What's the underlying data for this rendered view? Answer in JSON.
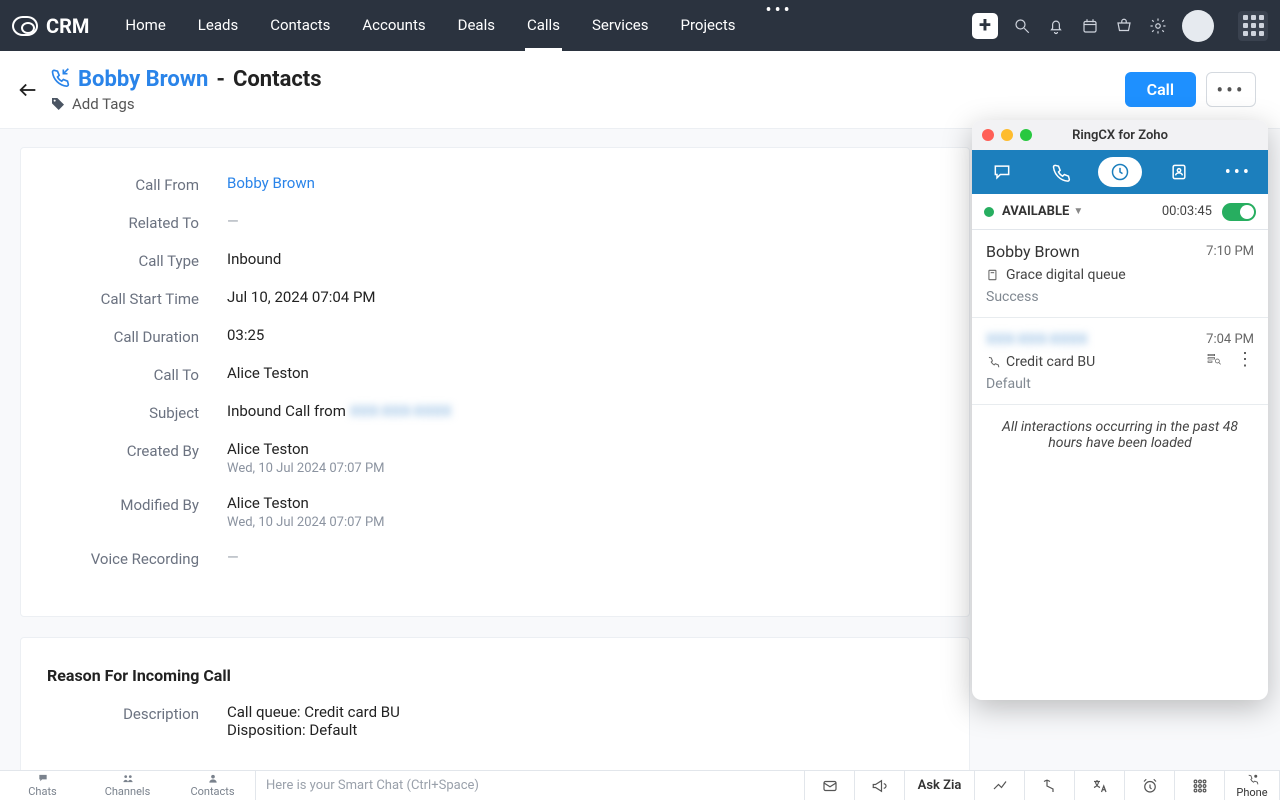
{
  "brand": "CRM",
  "nav": {
    "items": [
      "Home",
      "Leads",
      "Contacts",
      "Accounts",
      "Deals",
      "Calls",
      "Services",
      "Projects"
    ],
    "active": "Calls"
  },
  "header": {
    "contact_name": "Bobby Brown",
    "module": "Contacts",
    "add_tags": "Add Tags",
    "call_btn": "Call"
  },
  "details": {
    "labels": {
      "call_from": "Call From",
      "related_to": "Related To",
      "call_type": "Call Type",
      "call_start": "Call Start Time",
      "call_duration": "Call Duration",
      "call_to": "Call To",
      "subject": "Subject",
      "created_by": "Created By",
      "modified_by": "Modified By",
      "voice": "Voice Recording"
    },
    "values": {
      "call_from": "Bobby Brown",
      "related_to": "—",
      "call_type": "Inbound",
      "call_start": "Jul 10, 2024 07:04 PM",
      "call_duration": "03:25",
      "call_to": "Alice Teston",
      "subject_prefix": "Inbound Call from",
      "subject_redacted": "XXX-XXX-XXXX",
      "created_by": "Alice Teston",
      "created_ts": "Wed, 10 Jul 2024 07:07 PM",
      "modified_by": "Alice Teston",
      "modified_ts": "Wed, 10 Jul 2024 07:07 PM",
      "voice": "—"
    }
  },
  "reason": {
    "title": "Reason For Incoming Call",
    "desc_label": "Description",
    "desc_line1": "Call queue: Credit card BU",
    "desc_line2": "Disposition: Default"
  },
  "bottombar": {
    "tabs": [
      "Chats",
      "Channels",
      "Contacts"
    ],
    "placeholder": "Here is your Smart Chat (Ctrl+Space)",
    "askzia": "Ask Zia",
    "phone": "Phone"
  },
  "ringcx": {
    "title": "RingCX for Zoho",
    "status": "AVAILABLE",
    "timer": "00:03:45",
    "items": [
      {
        "name": "Bobby Brown",
        "time": "7:10 PM",
        "queue": "Grace digital queue",
        "disp": "Success"
      },
      {
        "name_redacted": "XXX-XXX-XXXX",
        "time": "7:04 PM",
        "queue": "Credit card BU",
        "disp": "Default"
      }
    ],
    "footer": "All interactions occurring in the past 48 hours have been loaded"
  }
}
